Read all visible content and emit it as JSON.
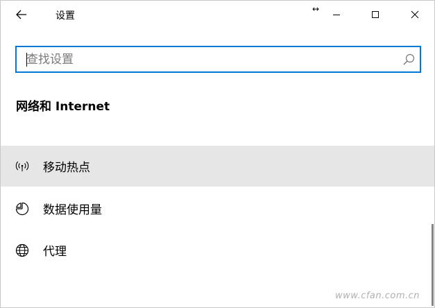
{
  "window": {
    "title": "设置"
  },
  "search": {
    "placeholder": "查找设置",
    "value": ""
  },
  "section": {
    "title": "网络和 Internet"
  },
  "nav": {
    "items": [
      {
        "label": "移动热点",
        "icon": "mobile-hotspot-icon",
        "selected": true
      },
      {
        "label": "数据使用量",
        "icon": "data-usage-icon",
        "selected": false
      },
      {
        "label": "代理",
        "icon": "globe-icon",
        "selected": false
      }
    ]
  },
  "watermark": {
    "text": "www.cfan.com.cn"
  },
  "colors": {
    "accent": "#0078d7",
    "selected_bg": "#e6e6e6"
  }
}
